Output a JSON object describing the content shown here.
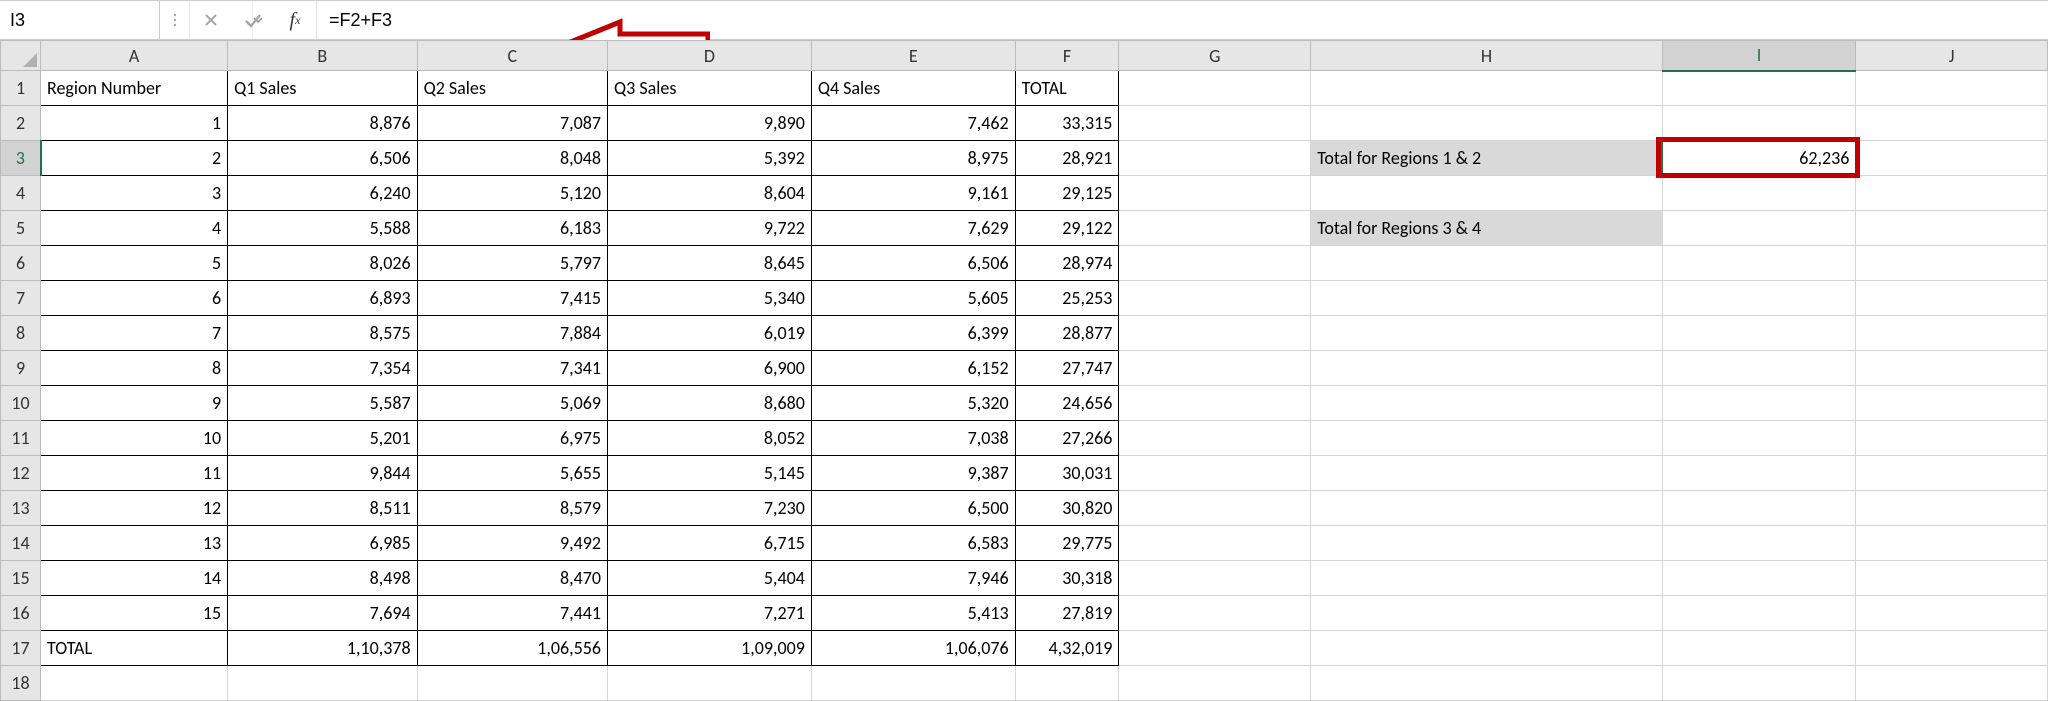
{
  "nameBox": "I3",
  "formula": "=F2+F3",
  "columns": [
    "A",
    "B",
    "C",
    "D",
    "E",
    "F",
    "G",
    "H",
    "I",
    "J"
  ],
  "selectedCol": "I",
  "selectedRow": 3,
  "headers": {
    "A": "Region Number",
    "B": "Q1 Sales",
    "C": "Q2 Sales",
    "D": "Q3 Sales",
    "E": "Q4 Sales",
    "F": "TOTAL"
  },
  "rows": [
    {
      "A": "1",
      "B": "8,876",
      "C": "7,087",
      "D": "9,890",
      "E": "7,462",
      "F": "33,315"
    },
    {
      "A": "2",
      "B": "6,506",
      "C": "8,048",
      "D": "5,392",
      "E": "8,975",
      "F": "28,921"
    },
    {
      "A": "3",
      "B": "6,240",
      "C": "5,120",
      "D": "8,604",
      "E": "9,161",
      "F": "29,125"
    },
    {
      "A": "4",
      "B": "5,588",
      "C": "6,183",
      "D": "9,722",
      "E": "7,629",
      "F": "29,122"
    },
    {
      "A": "5",
      "B": "8,026",
      "C": "5,797",
      "D": "8,645",
      "E": "6,506",
      "F": "28,974"
    },
    {
      "A": "6",
      "B": "6,893",
      "C": "7,415",
      "D": "5,340",
      "E": "5,605",
      "F": "25,253"
    },
    {
      "A": "7",
      "B": "8,575",
      "C": "7,884",
      "D": "6,019",
      "E": "6,399",
      "F": "28,877"
    },
    {
      "A": "8",
      "B": "7,354",
      "C": "7,341",
      "D": "6,900",
      "E": "6,152",
      "F": "27,747"
    },
    {
      "A": "9",
      "B": "5,587",
      "C": "5,069",
      "D": "8,680",
      "E": "5,320",
      "F": "24,656"
    },
    {
      "A": "10",
      "B": "5,201",
      "C": "6,975",
      "D": "8,052",
      "E": "7,038",
      "F": "27,266"
    },
    {
      "A": "11",
      "B": "9,844",
      "C": "5,655",
      "D": "5,145",
      "E": "9,387",
      "F": "30,031"
    },
    {
      "A": "12",
      "B": "8,511",
      "C": "8,579",
      "D": "7,230",
      "E": "6,500",
      "F": "30,820"
    },
    {
      "A": "13",
      "B": "6,985",
      "C": "9,492",
      "D": "6,715",
      "E": "6,583",
      "F": "29,775"
    },
    {
      "A": "14",
      "B": "8,498",
      "C": "8,470",
      "D": "5,404",
      "E": "7,946",
      "F": "30,318"
    },
    {
      "A": "15",
      "B": "7,694",
      "C": "7,441",
      "D": "7,271",
      "E": "5,413",
      "F": "27,819"
    }
  ],
  "totals": {
    "label": "TOTAL",
    "B": "1,10,378",
    "C": "1,06,556",
    "D": "1,09,009",
    "E": "1,06,076",
    "F": "4,32,019"
  },
  "side": {
    "H3": "Total for Regions 1 & 2",
    "I3": "62,236",
    "H5": "Total for Regions 3 & 4"
  },
  "annotationColor": "#c00000"
}
